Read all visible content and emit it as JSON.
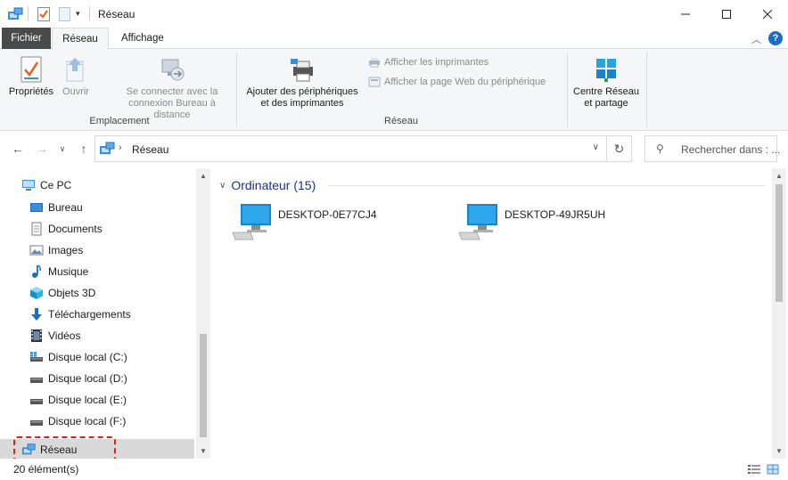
{
  "window": {
    "title": "Réseau",
    "controls": [
      "minimize",
      "maximize",
      "close"
    ]
  },
  "ribbon": {
    "tabs": {
      "file": "Fichier",
      "network": "Réseau",
      "view": "Affichage"
    },
    "location_group": {
      "label": "Emplacement",
      "properties": "Propriétés",
      "open": "Ouvrir",
      "connect_line1": "Se connecter avec la",
      "connect_line2": "connexion Bureau à distance"
    },
    "network_group": {
      "label": "Réseau",
      "add_devices_line1": "Ajouter des périphériques",
      "add_devices_line2": "et des imprimantes",
      "show_printers": "Afficher les imprimantes",
      "show_device_page": "Afficher la page Web du périphérique"
    },
    "network_center_line1": "Centre Réseau",
    "network_center_line2": "et partage"
  },
  "address_bar": {
    "path": "Réseau",
    "search_placeholder": "Rechercher dans : ..."
  },
  "sidebar": {
    "this_pc": "Ce PC",
    "items": [
      {
        "label": "Bureau",
        "icon": "desktop-icon"
      },
      {
        "label": "Documents",
        "icon": "documents-icon"
      },
      {
        "label": "Images",
        "icon": "images-icon"
      },
      {
        "label": "Musique",
        "icon": "music-icon"
      },
      {
        "label": "Objets 3D",
        "icon": "objects3d-icon"
      },
      {
        "label": "Téléchargements",
        "icon": "downloads-icon"
      },
      {
        "label": "Vidéos",
        "icon": "videos-icon"
      },
      {
        "label": "Disque local (C:)",
        "icon": "drive-c-icon"
      },
      {
        "label": "Disque local (D:)",
        "icon": "drive-icon"
      },
      {
        "label": "Disque local (E:)",
        "icon": "drive-icon"
      },
      {
        "label": "Disque local (F:)",
        "icon": "drive-icon"
      }
    ],
    "network": "Réseau"
  },
  "content": {
    "group_header": "Ordinateur (15)",
    "computers": [
      {
        "name": "DESKTOP-0E77CJ4"
      },
      {
        "name": "DESKTOP-49JR5UH"
      }
    ]
  },
  "status": {
    "count": "20 élément(s)"
  },
  "colors": {
    "accent_blue": "#1b6ec2",
    "group_header": "#1e3287",
    "file_tab": "#4a4a4a",
    "highlight": "#e0201f"
  }
}
